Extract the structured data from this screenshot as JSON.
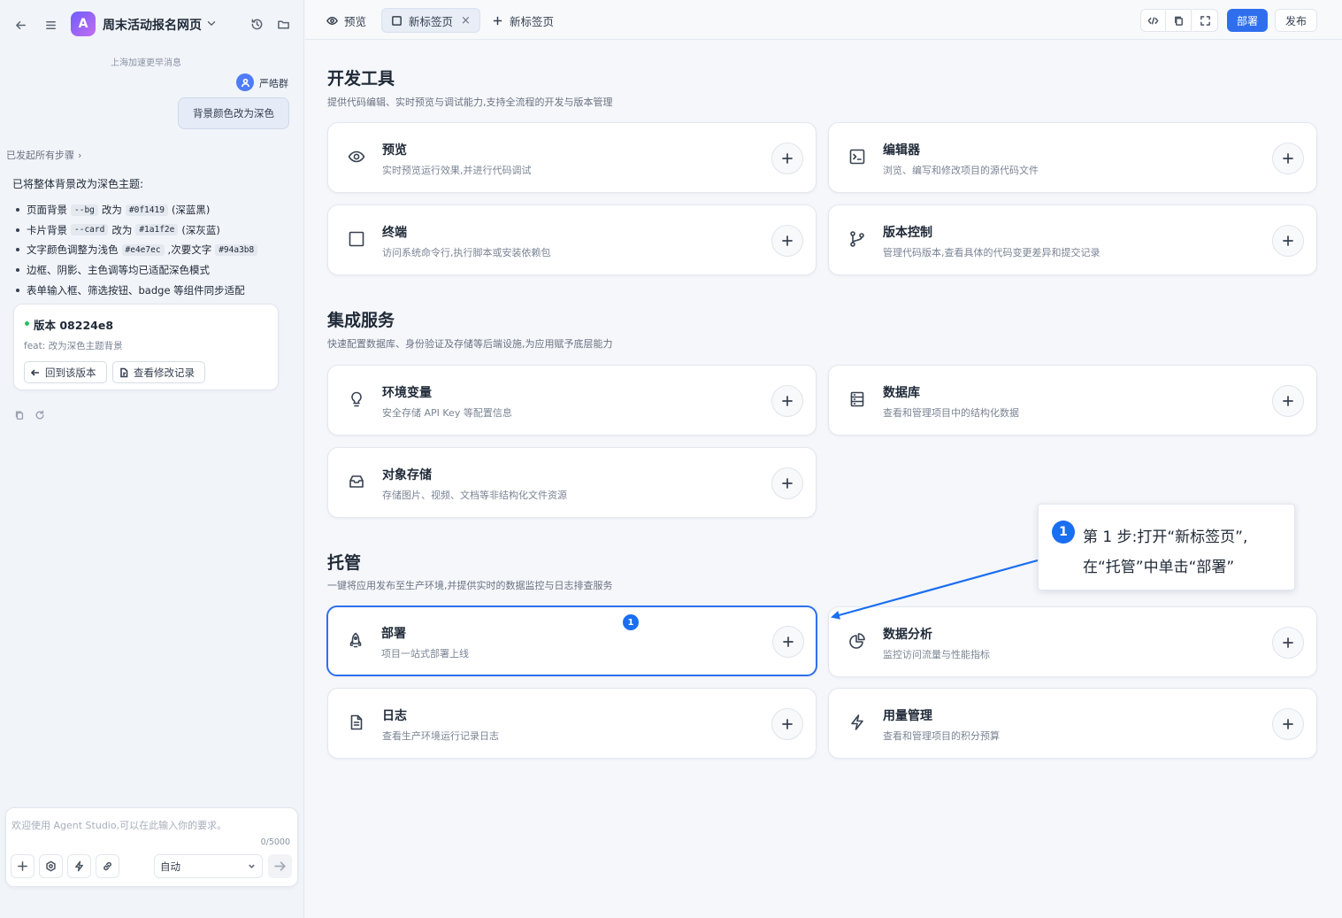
{
  "left": {
    "app_logo": "A",
    "app_title": "周末活动报名网页",
    "chat_hint": "上海加速更早消息",
    "user_name": "严皓群",
    "user_message": "背景颜色改为深色",
    "steps_link": "已发起所有步骤",
    "ai_intro": "已将整体背景改为深色主题:",
    "ai_items": [
      {
        "pre": "页面背景",
        "code1": "--bg",
        "mid": "改为",
        "code2": "#0f1419",
        "post": "(深蓝黑)"
      },
      {
        "pre": "卡片背景",
        "code1": "--card",
        "mid": "改为",
        "code2": "#1a1f2e",
        "post": "(深灰蓝)"
      },
      {
        "pre": "文字颜色调整为浅色",
        "code1": "#e4e7ec",
        "mid": ",次要文字",
        "code2": "#94a3b8",
        "post": ""
      },
      {
        "pre": "边框、阴影、主色调等均已适配深色模式"
      },
      {
        "pre": "表单输入框、筛选按钮、badge 等组件同步适配"
      }
    ],
    "version": {
      "title": "版本 08224e8",
      "desc": "feat: 改为深色主题背景",
      "rollback": "回到该版本",
      "changes": "查看修改记录"
    },
    "input": {
      "placeholder": "欢迎使用 Agent Studio,可以在此输入你的要求。",
      "count": "0/5000",
      "mode": "自动"
    }
  },
  "topbar": {
    "tab_preview": "预览",
    "tab_newtab": "新标签页",
    "tab_add": "新标签页",
    "deploy": "部署",
    "publish": "发布"
  },
  "sections": {
    "dev": {
      "title": "开发工具",
      "desc": "提供代码编辑、实时预览与调试能力,支持全流程的开发与版本管理",
      "cards": [
        {
          "title": "预览",
          "desc": "实时预览运行效果,并进行代码调试",
          "icon": "eye-icon"
        },
        {
          "title": "编辑器",
          "desc": "浏览、编写和修改项目的源代码文件",
          "icon": "terminal-icon"
        },
        {
          "title": "终端",
          "desc": "访问系统命令行,执行脚本或安装依赖包",
          "icon": "square-icon"
        },
        {
          "title": "版本控制",
          "desc": "管理代码版本,查看具体的代码变更差异和提交记录",
          "icon": "git-branch-icon"
        }
      ]
    },
    "integration": {
      "title": "集成服务",
      "desc": "快速配置数据库、身份验证及存储等后端设施,为应用赋予底层能力",
      "cards": [
        {
          "title": "环境变量",
          "desc": "安全存储 API Key 等配置信息",
          "icon": "lightbulb-icon"
        },
        {
          "title": "数据库",
          "desc": "查看和管理项目中的结构化数据",
          "icon": "database-icon"
        },
        {
          "title": "对象存储",
          "desc": "存储图片、视频、文档等非结构化文件资源",
          "icon": "inbox-icon"
        }
      ]
    },
    "hosting": {
      "title": "托管",
      "desc": "一键将应用发布至生产环境,并提供实时的数据监控与日志排查服务",
      "cards": [
        {
          "title": "部署",
          "desc": "项目一站式部署上线",
          "icon": "rocket-icon",
          "badge": "1"
        },
        {
          "title": "数据分析",
          "desc": "监控访问流量与性能指标",
          "icon": "pie-chart-icon"
        },
        {
          "title": "日志",
          "desc": "查看生产环境运行记录日志",
          "icon": "file-text-icon"
        },
        {
          "title": "用量管理",
          "desc": "查看和管理项目的积分预算",
          "icon": "zap-icon"
        }
      ]
    }
  },
  "callout": {
    "number": "1",
    "line1": "第 1 步:打开“新标签页”,",
    "line2": "在“托管”中单击“部署”"
  },
  "colors": {
    "accent": "#2f6fee",
    "badge": "#1a6ef0",
    "status_green": "#22c55e"
  }
}
